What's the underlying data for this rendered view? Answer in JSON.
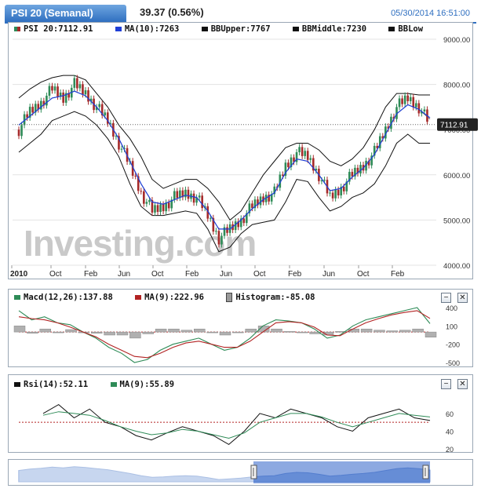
{
  "header": {
    "tab_label": "PSI 20 (Semanal)",
    "change": "39.37 (0.56%)",
    "datetime": "05/30/2014 16:51:00"
  },
  "watermark": "Investing.com",
  "main_legend": {
    "price": "PSI 20:7112.91",
    "ma": "MA(10):7263",
    "bb_upper": "BBUpper:7767",
    "bb_middle": "BBMiddle:7230",
    "bb_lower": "BBLow"
  },
  "price_tag": "7112.91",
  "x_tick_labels": [
    "2010",
    "Oct",
    "Feb",
    "Jun",
    "Oct",
    "Feb",
    "Jun",
    "Oct",
    "Feb",
    "Jun",
    "Oct",
    "Feb"
  ],
  "macd_legend": {
    "macd": "Macd(12,26):137.88",
    "ma": "MA(9):222.96",
    "hist": "Histogram:-85.08"
  },
  "rsi_legend": {
    "rsi": "Rsi(14):52.11",
    "ma": "MA(9):55.89"
  },
  "buttons": {
    "minimize": "−",
    "close": "✕"
  },
  "colors": {
    "accent": "#2f6fc0",
    "up_candle": "#2e8b57",
    "down_candle": "#a52a2a",
    "ma": "#1f3fd6",
    "bands": "#111111",
    "macd": "#2e8b57",
    "signal": "#b22222",
    "histogram": "#999999"
  },
  "chart_data": [
    {
      "type": "candlestick",
      "title": "PSI 20 (Semanal)",
      "series": [
        {
          "name": "PSI 20",
          "values": [
            7000,
            7400,
            7600,
            7900,
            7700,
            8000,
            7800,
            7500,
            7200,
            6700,
            6200,
            5600,
            5200,
            5300,
            5500,
            5600,
            5500,
            5100,
            4600,
            4800,
            5000,
            5300,
            5500,
            5600,
            6200,
            6500,
            6400,
            6000,
            5500,
            5700,
            6000,
            6200,
            6500,
            7000,
            7500,
            7700,
            7500,
            7113
          ]
        },
        {
          "name": "MA(10)",
          "values": [
            7100,
            7300,
            7500,
            7700,
            7750,
            7850,
            7750,
            7500,
            7200,
            6800,
            6300,
            5800,
            5400,
            5350,
            5450,
            5550,
            5500,
            5200,
            4800,
            4800,
            5000,
            5250,
            5450,
            5600,
            6050,
            6350,
            6300,
            6000,
            5650,
            5700,
            5950,
            6150,
            6450,
            6900,
            7350,
            7550,
            7450,
            7263
          ]
        },
        {
          "name": "BBUpper",
          "values": [
            7700,
            7900,
            8050,
            8150,
            8200,
            8200,
            8100,
            7800,
            7500,
            7100,
            6800,
            6400,
            5900,
            5700,
            5800,
            5900,
            5900,
            5700,
            5400,
            5000,
            5200,
            5600,
            6000,
            6300,
            6600,
            6700,
            6700,
            6550,
            6300,
            6200,
            6350,
            6600,
            7000,
            7500,
            7800,
            7800,
            7767,
            7767
          ]
        },
        {
          "name": "BBMiddle",
          "values": [
            7100,
            7300,
            7500,
            7700,
            7750,
            7850,
            7750,
            7500,
            7200,
            6800,
            6300,
            5800,
            5400,
            5350,
            5450,
            5550,
            5500,
            5200,
            4800,
            4800,
            5000,
            5250,
            5450,
            5600,
            6050,
            6350,
            6300,
            6000,
            5650,
            5700,
            5950,
            6150,
            6450,
            6900,
            7350,
            7550,
            7450,
            7230
          ]
        },
        {
          "name": "BBLow",
          "values": [
            6500,
            6700,
            6900,
            7200,
            7300,
            7400,
            7300,
            7100,
            6800,
            6400,
            5800,
            5300,
            5100,
            5100,
            5150,
            5200,
            5150,
            4800,
            4300,
            4400,
            4700,
            4900,
            4950,
            5000,
            5400,
            5900,
            5850,
            5500,
            5200,
            5300,
            5500,
            5600,
            5800,
            6200,
            6700,
            6900,
            6700,
            6700
          ]
        }
      ],
      "y_ticks": [
        "9000.00",
        "8000.00",
        "7000.00",
        "6000.00",
        "5000.00",
        "4000.00"
      ],
      "ylim": [
        4000,
        9000
      ]
    },
    {
      "type": "line",
      "series": [
        {
          "name": "Macd(12,26)",
          "values": [
            350,
            200,
            250,
            150,
            120,
            0,
            -100,
            -250,
            -350,
            -500,
            -450,
            -300,
            -200,
            -150,
            -100,
            -200,
            -300,
            -250,
            -100,
            100,
            200,
            180,
            150,
            50,
            -100,
            -50,
            100,
            200,
            250,
            300,
            350,
            400,
            138
          ]
        },
        {
          "name": "MA(9)",
          "values": [
            250,
            220,
            200,
            150,
            80,
            0,
            -80,
            -200,
            -300,
            -400,
            -420,
            -350,
            -250,
            -180,
            -150,
            -200,
            -250,
            -250,
            -150,
            0,
            150,
            170,
            150,
            80,
            -50,
            -60,
            50,
            150,
            220,
            280,
            320,
            350,
            223
          ]
        }
      ],
      "y_ticks": [
        "400",
        "100",
        "-200",
        "-500"
      ],
      "ylim": [
        -500,
        400
      ]
    },
    {
      "type": "line",
      "series": [
        {
          "name": "Rsi(14)",
          "values": [
            60,
            70,
            55,
            65,
            50,
            45,
            35,
            30,
            38,
            45,
            40,
            35,
            25,
            40,
            60,
            55,
            65,
            60,
            55,
            45,
            40,
            55,
            60,
            65,
            55,
            52
          ]
        },
        {
          "name": "MA(9)",
          "values": [
            58,
            62,
            60,
            58,
            52,
            45,
            40,
            36,
            38,
            42,
            40,
            36,
            32,
            38,
            50,
            55,
            60,
            60,
            56,
            50,
            45,
            50,
            55,
            60,
            58,
            56
          ]
        }
      ],
      "y_ticks": [
        "60",
        "40",
        "20"
      ],
      "ylim": [
        20,
        75
      ]
    }
  ]
}
